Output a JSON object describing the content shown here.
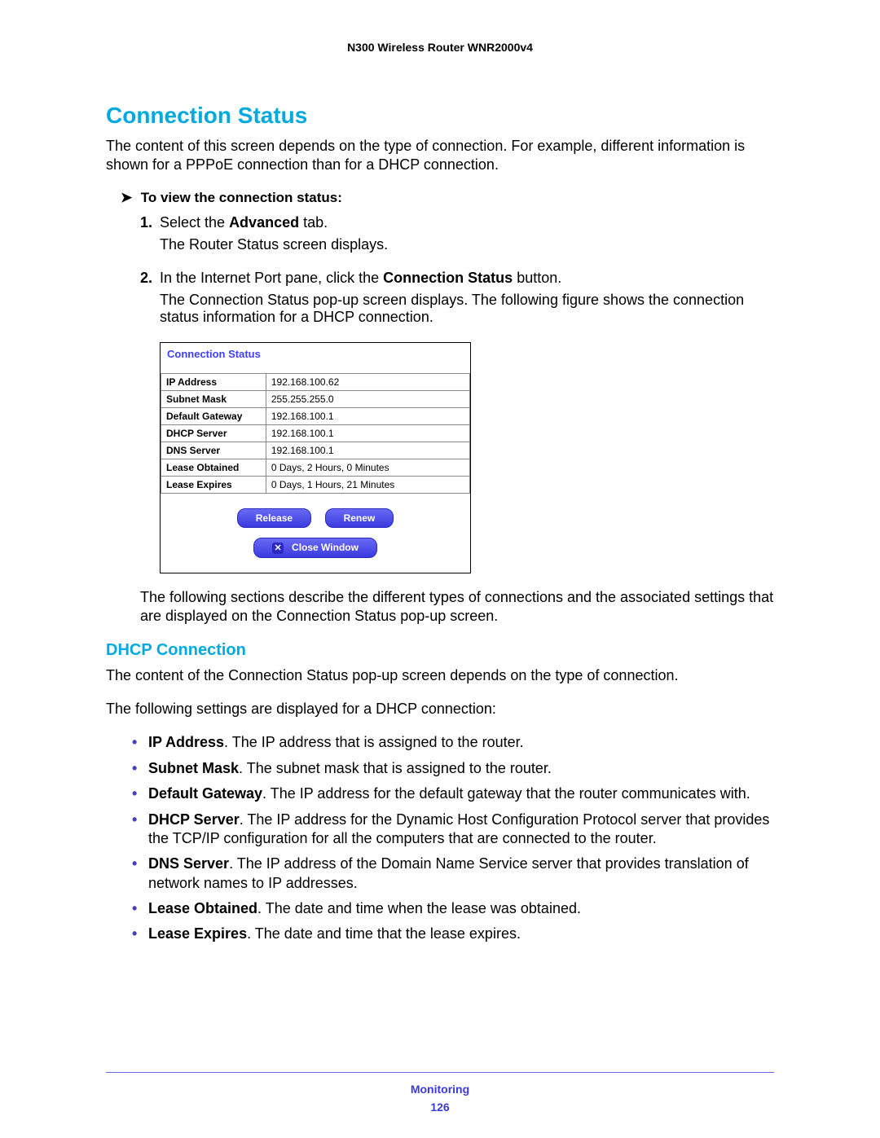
{
  "header": {
    "title": "N300 Wireless Router WNR2000v4"
  },
  "section": {
    "title": "Connection Status",
    "intro": "The content of this screen depends on the type of connection. For example, different information is shown for a PPPoE connection than for a DHCP connection.",
    "task_arrow": "➤",
    "task_label": "To view the connection status:",
    "steps": [
      {
        "num": "1.",
        "line_before": "Select the ",
        "bold1": "Advanced",
        "line_after": " tab.",
        "para": "The Router Status screen displays."
      },
      {
        "num": "2.",
        "line_before": "In the Internet Port pane, click the ",
        "bold1": "Connection Status",
        "line_after": " button.",
        "para": "The Connection Status pop-up screen displays. The following figure shows the connection status information for a DHCP connection."
      }
    ],
    "popup": {
      "title": "Connection Status",
      "rows": [
        {
          "label": "IP Address",
          "value": "192.168.100.62"
        },
        {
          "label": "Subnet Mask",
          "value": "255.255.255.0"
        },
        {
          "label": "Default Gateway",
          "value": "192.168.100.1"
        },
        {
          "label": "DHCP Server",
          "value": "192.168.100.1"
        },
        {
          "label": "DNS Server",
          "value": "192.168.100.1"
        },
        {
          "label": "Lease Obtained",
          "value": "0 Days, 2 Hours, 0 Minutes"
        },
        {
          "label": "Lease Expires",
          "value": "0 Days, 1 Hours, 21 Minutes"
        }
      ],
      "btn_release": "Release",
      "btn_renew": "Renew",
      "btn_close_x": "✕",
      "btn_close": "Close Window"
    },
    "after_popup": "The following sections describe the different types of connections and the associated settings that are displayed on the Connection Status pop-up screen."
  },
  "dhcp": {
    "title": "DHCP Connection",
    "p1": "The content of the Connection Status pop-up screen depends on the type of connection.",
    "p2": "The following settings are displayed for a DHCP connection:",
    "bullets": [
      {
        "bold": "IP Address",
        "text": ". The IP address that is assigned to the router."
      },
      {
        "bold": "Subnet Mask",
        "text": ". The subnet mask that is assigned to the router."
      },
      {
        "bold": "Default Gateway",
        "text": ". The IP address for the default gateway that the router communicates with."
      },
      {
        "bold": "DHCP Server",
        "text": ". The IP address for the Dynamic Host Configuration Protocol server that provides the TCP/IP configuration for all the computers that are connected to the router."
      },
      {
        "bold": "DNS Server",
        "text": ". The IP address of the Domain Name Service server that provides translation of network names to IP addresses."
      },
      {
        "bold": "Lease Obtained",
        "text": ". The date and time when the lease was obtained."
      },
      {
        "bold": "Lease Expires",
        "text": ". The date and time that the lease expires."
      }
    ]
  },
  "footer": {
    "label": "Monitoring",
    "page": "126"
  }
}
